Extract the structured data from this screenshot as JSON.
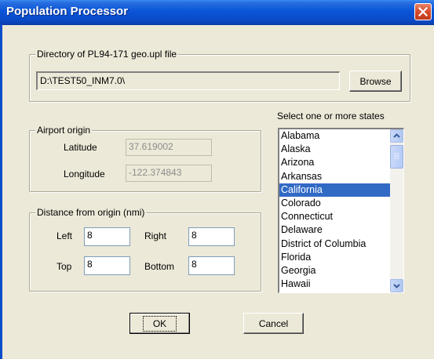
{
  "window": {
    "title": "Population Processor"
  },
  "directory": {
    "legend": "Directory of PL94-171 geo.upl file",
    "value": "D:\\TEST50_INM7.0\\",
    "browse_label": "Browse"
  },
  "airport": {
    "legend": "Airport origin",
    "latitude_label": "Latitude",
    "latitude_value": "37.619002",
    "longitude_label": "Longitude",
    "longitude_value": "-122.374843"
  },
  "distance": {
    "legend": "Distance from origin (nmi)",
    "left_label": "Left",
    "left_value": "8",
    "right_label": "Right",
    "right_value": "8",
    "top_label": "Top",
    "top_value": "8",
    "bottom_label": "Bottom",
    "bottom_value": "8"
  },
  "states": {
    "label": "Select one or more states",
    "items": [
      "Alabama",
      "Alaska",
      "Arizona",
      "Arkansas",
      "California",
      "Colorado",
      "Connecticut",
      "Delaware",
      "District of Columbia",
      "Florida",
      "Georgia",
      "Hawaii"
    ],
    "selected": "California"
  },
  "buttons": {
    "ok_label": "OK",
    "cancel_label": "Cancel"
  },
  "colors": {
    "titlebar": "#0a55d8",
    "selection": "#316ac5",
    "dialog": "#ECE9D8"
  },
  "icons": {
    "close": "close-icon",
    "scroll_up": "chevron-up-icon",
    "scroll_down": "chevron-down-icon"
  }
}
